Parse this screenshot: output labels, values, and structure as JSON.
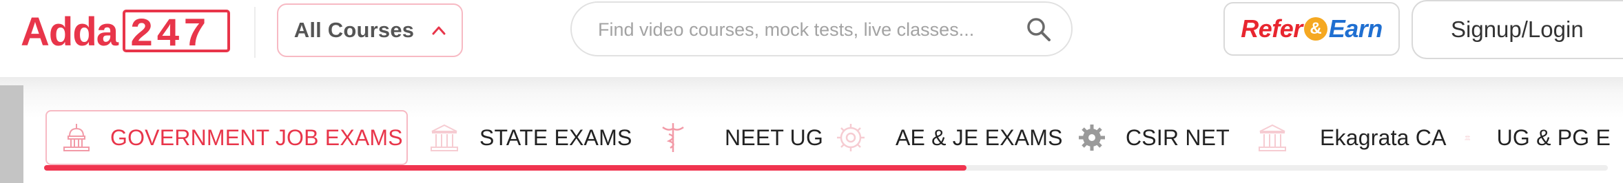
{
  "brand": {
    "name": "Adda247",
    "primary_color": "#e8354a"
  },
  "header": {
    "courses_dropdown_label": "All Courses",
    "search": {
      "placeholder": "Find video courses, mock tests, live classes...",
      "value": ""
    },
    "refer": {
      "part1": "Refer",
      "amp": "&",
      "part2": "Earn"
    },
    "signup_label": "Signup/Login"
  },
  "nav": {
    "tabs": [
      {
        "label": "GOVERNMENT JOB EXAMS",
        "icon": "capitol-building-icon",
        "active": true
      },
      {
        "label": "STATE EXAMS",
        "icon": "state-building-icon",
        "active": false
      },
      {
        "label": "NEET UG",
        "icon": "caduceus-icon",
        "active": false
      },
      {
        "label": "AE & JE EXAMS",
        "icon": "engineering-gear-icon",
        "active": false
      },
      {
        "label": "CSIR NET",
        "icon": "gear-icon",
        "active": false
      },
      {
        "label": "Ekagrata CA",
        "icon": "state-building-icon",
        "active": false
      },
      {
        "label": "UG & PG E",
        "icon": "state-building-icon",
        "active": false
      }
    ],
    "scroll_progress": 0.59
  }
}
